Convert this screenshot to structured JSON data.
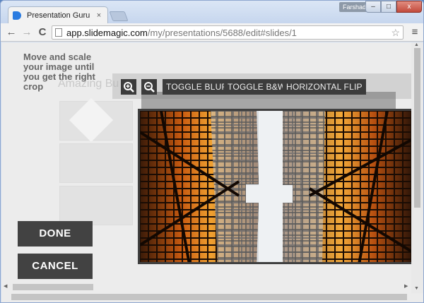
{
  "browser": {
    "tab_title": "Presentation Guru",
    "tab_close": "×",
    "user_name": "Farshad",
    "window_buttons": {
      "minimize": "–",
      "maximize": "□",
      "close": "x"
    },
    "back": "←",
    "forward": "→",
    "reload": "C",
    "url_host": "app.slidemagic.com",
    "url_path": "/my/presentations/5688/edit#slides/1",
    "star": "☆",
    "menu": "≡"
  },
  "editor": {
    "instruction": "Move and scale your image until you get the right crop",
    "background_title": "Amazing Bu",
    "toolbar": {
      "zoom_in_icon": "zoom-in-icon",
      "zoom_out_icon": "zoom-out-icon",
      "toggle_blur": "TOGGLE BLUR",
      "toggle_bw": "TOGGLE B&W",
      "horizontal_flip": "HORIZONTAL FLIP"
    },
    "done_label": "DONE",
    "cancel_label": "CANCEL"
  },
  "colors": {
    "button_bg": "#424242",
    "toolbar_button_bg": "#3c3c3c",
    "building_orange": "#e07a1a",
    "sky": "#e8ecef"
  }
}
